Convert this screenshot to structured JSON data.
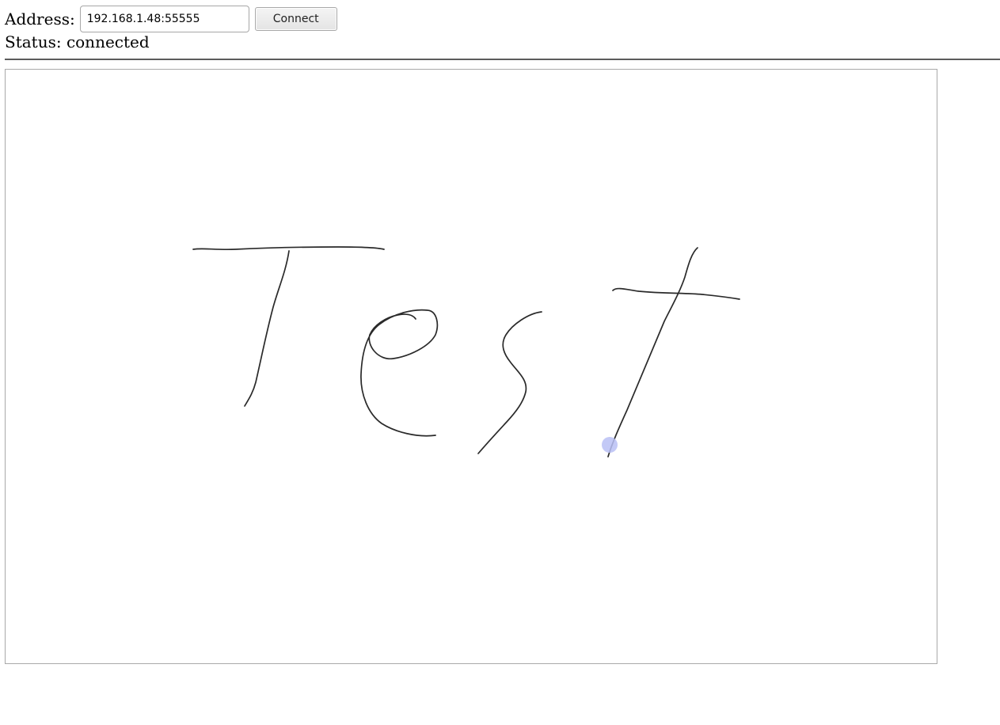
{
  "header": {
    "address_label": "Address:",
    "address_value": "192.168.1.48:55555",
    "connect_label": "Connect"
  },
  "status": {
    "text": "Status: connected"
  },
  "canvas": {
    "stroke_color": "#2a2a2a",
    "cursor_color": "#b8bff5"
  }
}
